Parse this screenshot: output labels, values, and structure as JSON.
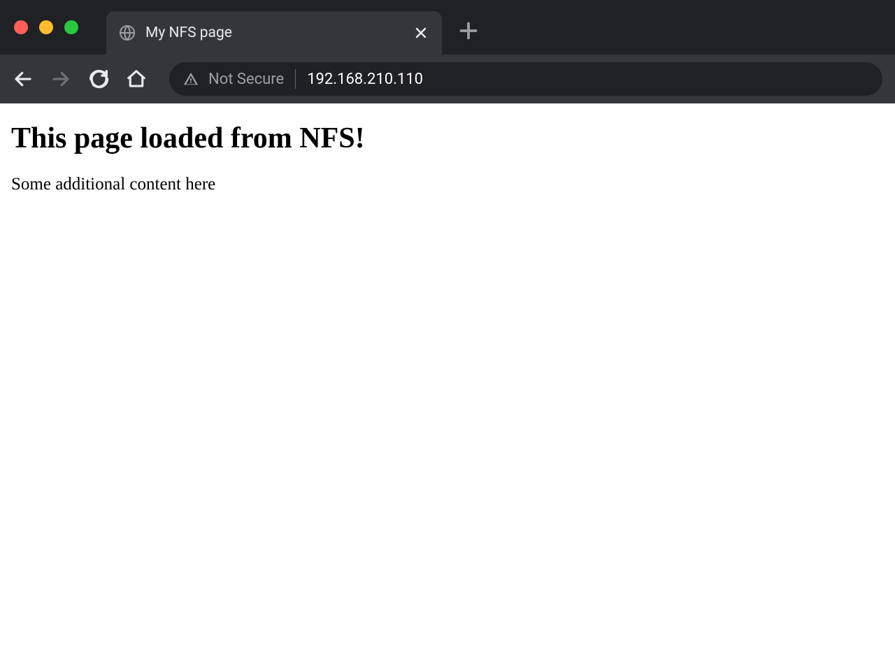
{
  "tab": {
    "title": "My NFS page"
  },
  "addressBar": {
    "securityText": "Not Secure",
    "url": "192.168.210.110"
  },
  "page": {
    "heading": "This page loaded from NFS!",
    "paragraph": "Some additional content here"
  }
}
